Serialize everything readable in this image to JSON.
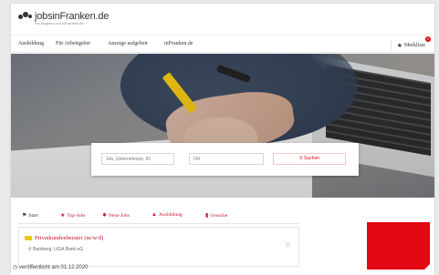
{
  "header": {
    "logo_text": "jobsinFranken.de",
    "logo_tagline": "Ein Angebot von inFranken.de"
  },
  "nav": {
    "items": [
      "Ausbildung",
      "Für Arbeitgeber",
      "Anzeige aufgeben",
      "inFranken.de"
    ],
    "bookmark_label": "Merkliste",
    "bookmark_count": "0"
  },
  "search": {
    "keyword_placeholder": "Job, Unternehmen, ID",
    "location_placeholder": "Ort",
    "button_label": "Suchen"
  },
  "tabs": [
    {
      "label": "Start",
      "icon": "flag-icon"
    },
    {
      "label": "Top-Jobs",
      "icon": "star-icon"
    },
    {
      "label": "Neue Jobs",
      "icon": "new-icon"
    },
    {
      "label": "Ausbildung",
      "icon": "graduation-icon"
    },
    {
      "label": "Gesuche",
      "icon": "trash-icon"
    }
  ],
  "job": {
    "title": "Privatkundenberater (m/w/d)",
    "company": "Bamberg, LIGA Bank eG",
    "published": "veröffentlicht am 01.12.2020"
  },
  "colors": {
    "accent": "#e30613",
    "highlight": "#f0c513"
  }
}
